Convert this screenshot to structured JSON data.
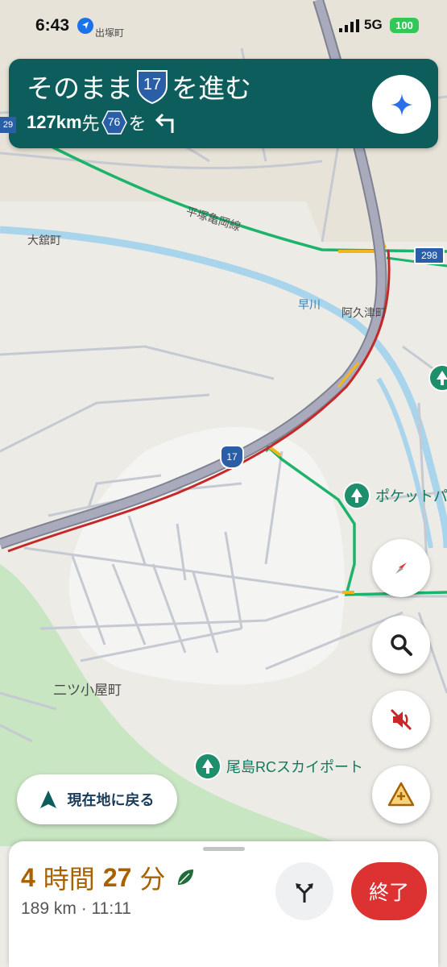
{
  "status_bar": {
    "time": "6:43",
    "network": "5G",
    "battery": "100"
  },
  "navigation": {
    "instruction_prefix": "そのまま",
    "instruction_route": "17",
    "instruction_suffix": "を進む",
    "next_distance": "127km",
    "next_distance_suffix": "先",
    "next_route": "76",
    "next_route_suffix": "を",
    "edge_route": "29"
  },
  "map": {
    "labels": {
      "izuka": "出塚町",
      "road_name": "平塚亀岡線",
      "odate": "大舘町",
      "hayakawa": "早川",
      "akutsu": "阿久津町",
      "futatsugoya": "二ツ小屋町"
    },
    "route_shields": {
      "r298": "298",
      "r17": "17"
    },
    "pois": {
      "pocket_park": "ポケットパ",
      "ojima_rc": "尾島RCスカイポート"
    },
    "colors": {
      "route": "#a9abbc",
      "traffic_heavy": "#c62828",
      "traffic_slow": "#f2b61d",
      "traffic_free": "#1db36a",
      "river": "#a8d4ec",
      "park": "#c9e6c3"
    }
  },
  "controls": {
    "recenter_label": "現在地に戻る"
  },
  "trip": {
    "hours": "4",
    "hours_unit": "時間",
    "minutes": "27",
    "minutes_unit": "分",
    "distance_arrival": "189 km · 11:11",
    "end_label": "終了"
  }
}
